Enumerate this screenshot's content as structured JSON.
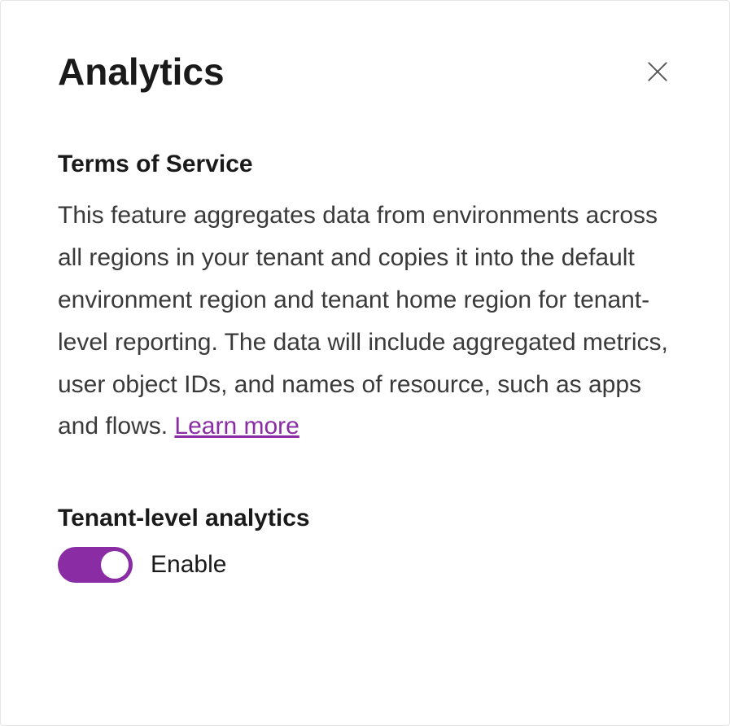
{
  "header": {
    "title": "Analytics"
  },
  "terms": {
    "heading": "Terms of Service",
    "body_prefix": "This feature aggregates data from environments across all regions in your tenant and copies it into the default environment region and tenant home region for tenant-level reporting. The data will include aggregated metrics, user object IDs, and names of resource, such as apps and flows. ",
    "learn_more": "Learn more"
  },
  "toggle_section": {
    "heading": "Tenant-level analytics",
    "state_label": "Enable",
    "enabled": true
  },
  "colors": {
    "accent": "#8a2da5",
    "link": "#8a2da5"
  }
}
